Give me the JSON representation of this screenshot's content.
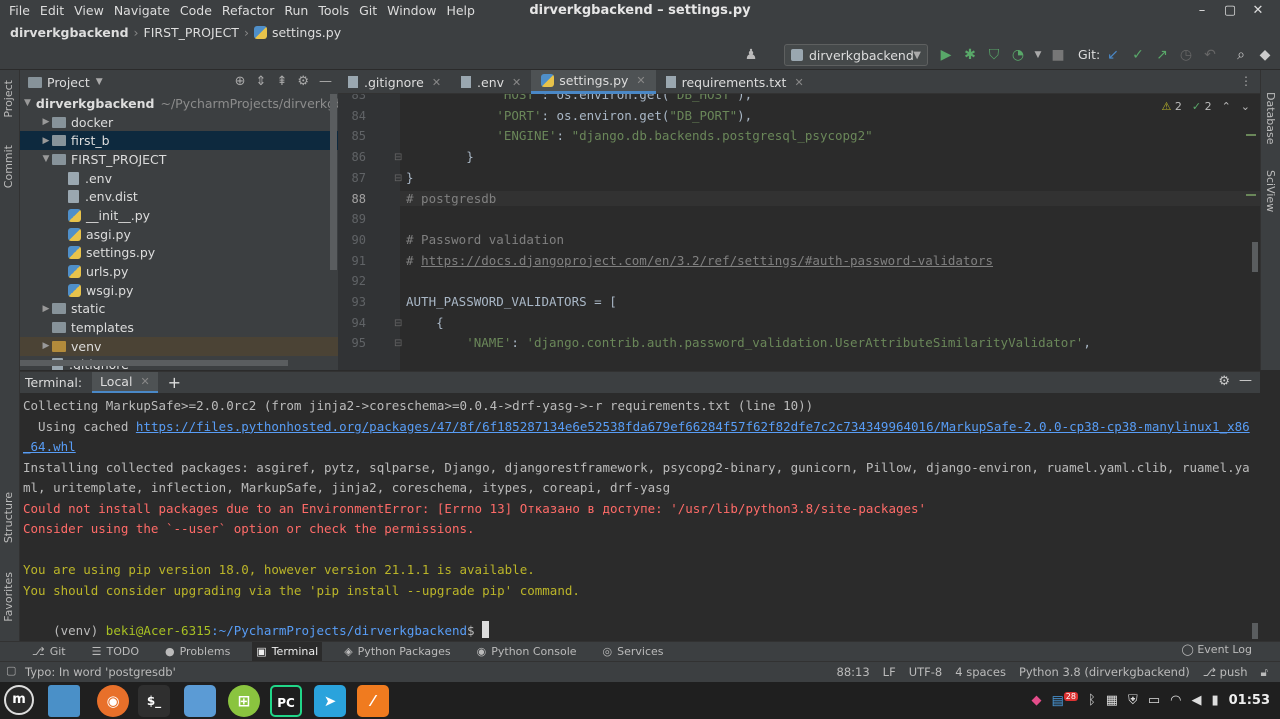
{
  "window": {
    "title": "dirverkgbackend – settings.py",
    "controls": [
      "–",
      "▢",
      "✕"
    ]
  },
  "menu": [
    "File",
    "Edit",
    "View",
    "Navigate",
    "Code",
    "Refactor",
    "Run",
    "Tools",
    "Git",
    "Window",
    "Help"
  ],
  "breadcrumbs": [
    "dirverkgbackend",
    "FIRST_PROJECT",
    "settings.py"
  ],
  "run_config": "dirverkgbackend",
  "git_label": "Git:",
  "side_tabs": {
    "project": "Project",
    "commit": "Commit",
    "structure": "Structure",
    "favorites": "Favorites",
    "database": "Database",
    "sciview": "SciView"
  },
  "project_panel": {
    "title": "Project",
    "tree": [
      {
        "label": "dirverkgbackend",
        "path": "~/PycharmProjects/dirverkgbackend",
        "kind": "folder",
        "depth": 0,
        "expanded": true
      },
      {
        "label": "docker",
        "kind": "folder",
        "depth": 1,
        "expanded": false
      },
      {
        "label": "first_b",
        "kind": "folder",
        "depth": 1,
        "expanded": false,
        "selected": true
      },
      {
        "label": "FIRST_PROJECT",
        "kind": "folder",
        "depth": 1,
        "expanded": true
      },
      {
        "label": ".env",
        "kind": "file",
        "depth": 2
      },
      {
        "label": ".env.dist",
        "kind": "file",
        "depth": 2
      },
      {
        "label": "__init__.py",
        "kind": "py",
        "depth": 2
      },
      {
        "label": "asgi.py",
        "kind": "py",
        "depth": 2
      },
      {
        "label": "settings.py",
        "kind": "py",
        "depth": 2
      },
      {
        "label": "urls.py",
        "kind": "py",
        "depth": 2
      },
      {
        "label": "wsgi.py",
        "kind": "py",
        "depth": 2
      },
      {
        "label": "static",
        "kind": "folder",
        "depth": 1,
        "expanded": false
      },
      {
        "label": "templates",
        "kind": "folder",
        "depth": 1
      },
      {
        "label": "venv",
        "kind": "folder-excluded",
        "depth": 1,
        "expanded": false
      },
      {
        "label": ".gitignore",
        "kind": "file",
        "depth": 1
      }
    ]
  },
  "editor_tabs": [
    {
      "label": ".gitignore",
      "active": false
    },
    {
      "label": ".env",
      "active": false
    },
    {
      "label": "settings.py",
      "active": true
    },
    {
      "label": "requirements.txt",
      "active": false
    }
  ],
  "inspections": {
    "warnings": "2",
    "typos": "2"
  },
  "code_lines": [
    {
      "n": "83",
      "html": "            <span class='str'>'HOST'</span>: os.environ.get(<span class='str'>\"DB_HOST\"</span>),"
    },
    {
      "n": "84",
      "html": "            <span class='str'>'PORT'</span>: os.environ.get(<span class='str'>\"DB_PORT\"</span>),"
    },
    {
      "n": "85",
      "html": "            <span class='str'>'ENGINE'</span>: <span class='str'>\"django.db.backends.postgresql_psycopg2\"</span>"
    },
    {
      "n": "86",
      "html": "        }"
    },
    {
      "n": "87",
      "html": "}"
    },
    {
      "n": "88",
      "html": "<span class='cmt'># postgresdb</span>"
    },
    {
      "n": "89",
      "html": ""
    },
    {
      "n": "90",
      "html": "<span class='cmt'># Password validation</span>"
    },
    {
      "n": "91",
      "html": "<span class='cmt'># </span><span class='link'>https://docs.djangoproject.com/en/3.2/ref/settings/#auth-password-validators</span>"
    },
    {
      "n": "92",
      "html": ""
    },
    {
      "n": "93",
      "html": "AUTH_PASSWORD_VALIDATORS = ["
    },
    {
      "n": "94",
      "html": "    {"
    },
    {
      "n": "95",
      "html": "        <span class='str'>'NAME'</span>: <span class='str'>'django.contrib.auth.password_validation.UserAttributeSimilarityValidator'</span>,"
    }
  ],
  "current_line": "88",
  "terminal": {
    "label": "Terminal:",
    "tab": "Local",
    "lines": [
      {
        "type": "normal",
        "text": "Collecting MarkupSafe>=2.0.0rc2 (from jinja2->coreschema>=0.0.4->drf-yasg->-r requirements.txt (line 10))"
      },
      {
        "type": "normal",
        "prefix": "  Using cached ",
        "link": "https://files.pythonhosted.org/packages/47/8f/6f185287134e6e52538fda679ef66284f57f62f82dfe7c2c734349964016/MarkupSafe-2.0.0-cp38-cp38-manylinux1_x86"
      },
      {
        "type": "normal",
        "link": "_64.whl"
      },
      {
        "type": "normal",
        "text": "Installing collected packages: asgiref, pytz, sqlparse, Django, djangorestframework, psycopg2-binary, gunicorn, Pillow, django-environ, ruamel.yaml.clib, ruamel.ya"
      },
      {
        "type": "normal",
        "text": "ml, uritemplate, inflection, MarkupSafe, jinja2, coreschema, itypes, coreapi, drf-yasg"
      },
      {
        "type": "err",
        "text": "Could not install packages due to an EnvironmentError: [Errno 13] Отказано в доступе: '/usr/lib/python3.8/site-packages'"
      },
      {
        "type": "err",
        "text": "Consider using the `--user` option or check the permissions."
      },
      {
        "type": "normal",
        "text": ""
      },
      {
        "type": "warn",
        "text": "You are using pip version 18.0, however version 21.1.1 is available."
      },
      {
        "type": "warn",
        "text": "You should consider upgrading via the 'pip install --upgrade pip' command."
      }
    ],
    "prompt": {
      "env": "(venv) ",
      "user": "beki@Acer-6315",
      "path": ":~/PycharmProjects/dirverkgbackend",
      "symbol": "$"
    }
  },
  "tool_windows": [
    {
      "label": "Git",
      "glyph": "⎇",
      "active": false
    },
    {
      "label": "TODO",
      "glyph": "☰",
      "active": false
    },
    {
      "label": "Problems",
      "glyph": "●",
      "active": false
    },
    {
      "label": "Terminal",
      "glyph": "▣",
      "active": true
    },
    {
      "label": "Python Packages",
      "glyph": "◈",
      "active": false
    },
    {
      "label": "Python Console",
      "glyph": "◉",
      "active": false
    },
    {
      "label": "Services",
      "glyph": "◎",
      "active": false
    }
  ],
  "event_log": "Event Log",
  "status": {
    "message": "Typo: In word 'postgresdb'",
    "position": "88:13",
    "line_sep": "LF",
    "encoding": "UTF-8",
    "indent": "4 spaces",
    "interpreter": "Python 3.8 (dirverkgbackend)",
    "git_action": "push"
  },
  "taskbar": {
    "clock": "01:53",
    "badge": "28"
  },
  "colors": {
    "accent": "#4a88c7",
    "error": "#ff6b68",
    "warning": "#bbb529",
    "link": "#589df6",
    "prompt_user": "#a8c023"
  }
}
